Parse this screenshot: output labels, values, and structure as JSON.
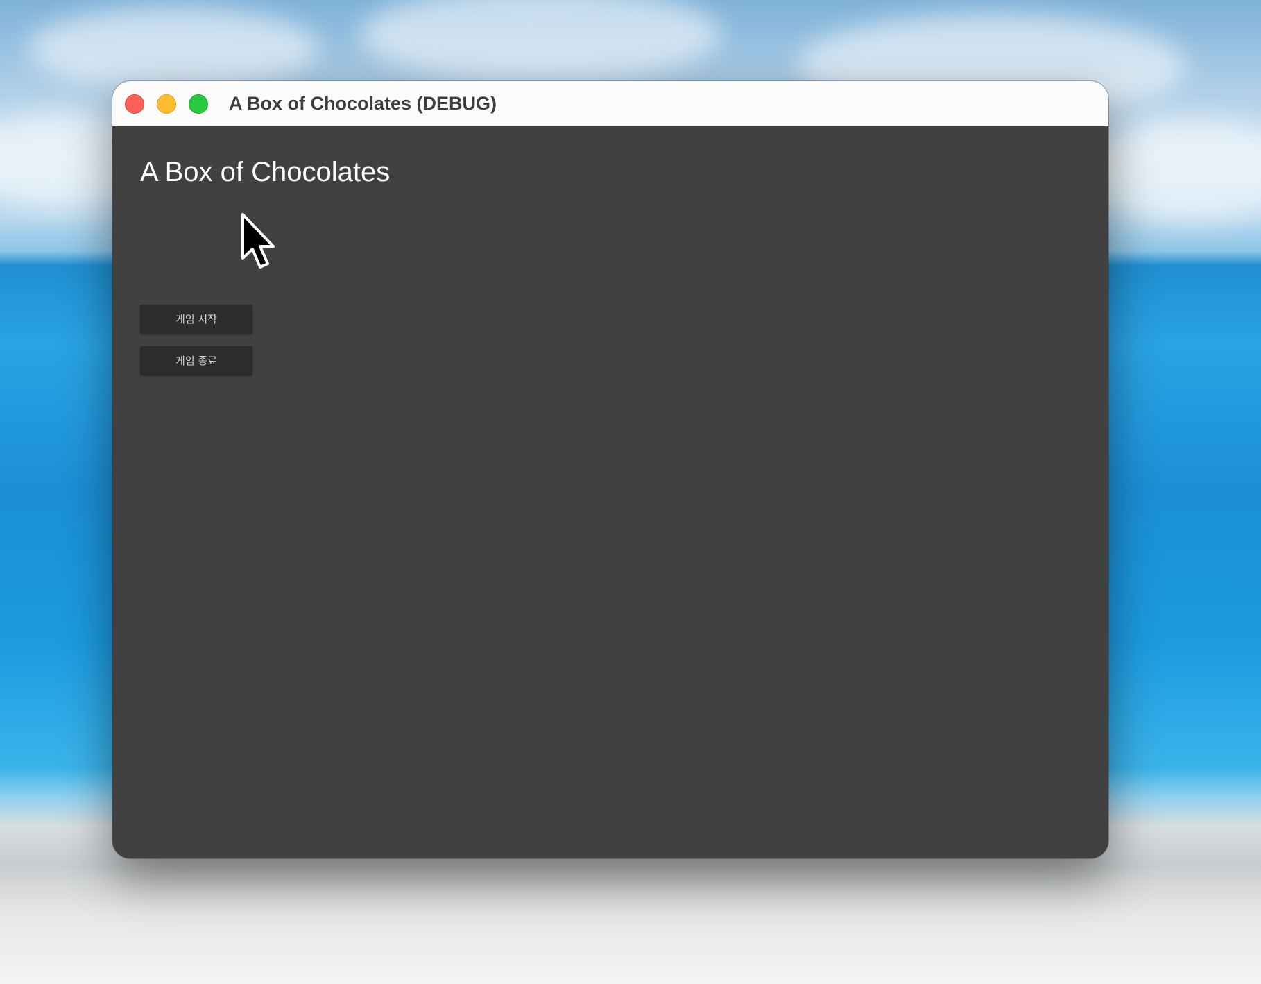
{
  "window": {
    "title": "A Box of Chocolates (DEBUG)",
    "controls": {
      "close": "close-button",
      "minimize": "minimize-button",
      "zoom": "zoom-button"
    }
  },
  "app": {
    "heading": "A Box of Chocolates",
    "buttons": {
      "start_label": "게임 시작",
      "quit_label": "게임 종료"
    }
  },
  "colors": {
    "content_background": "#414141",
    "button_background": "#2c2c2c",
    "button_text": "#d4d4d4",
    "heading_text": "#ffffff",
    "close": "#fe5f57",
    "minimize": "#febc2e",
    "zoom": "#28c840"
  },
  "icons": {
    "pointer": "mouse-pointer-icon"
  }
}
